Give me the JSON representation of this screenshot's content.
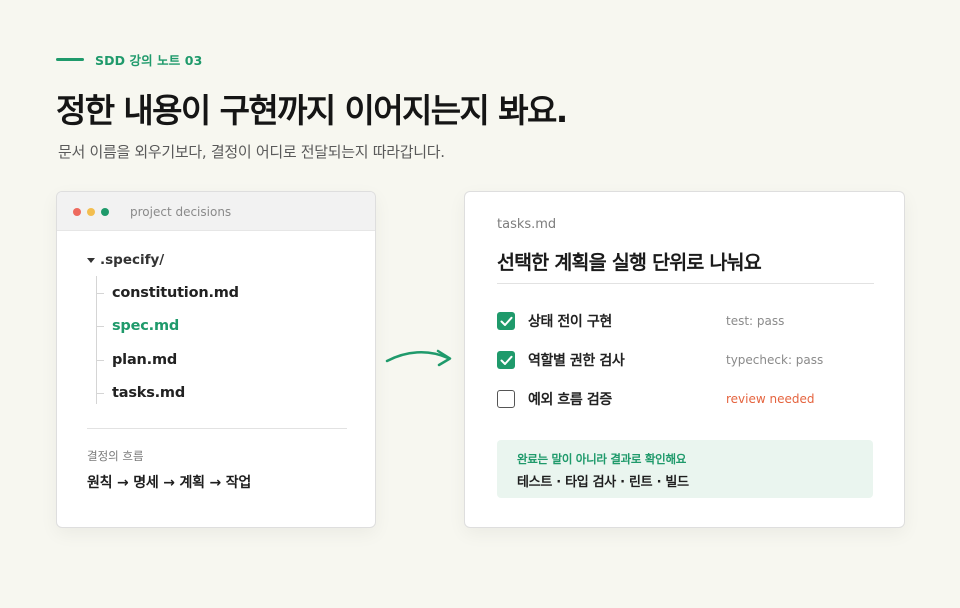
{
  "header": {
    "eyebrow": "SDD 강의 노트 03",
    "headline": "정한 내용이 구현까지 이어지는지 봐요.",
    "subtitle": "문서 이름을 외우기보다, 결정이 어디로 전달되는지 따라갑니다."
  },
  "left_panel": {
    "window_title": "project decisions",
    "folder": ".specify/",
    "files": [
      {
        "name": "constitution.md",
        "active": false
      },
      {
        "name": "spec.md",
        "active": true
      },
      {
        "name": "plan.md",
        "active": false
      },
      {
        "name": "tasks.md",
        "active": false
      }
    ],
    "flow_label": "결정의 흐름",
    "flow_value": "원칙 → 명세 → 계획 → 작업"
  },
  "right_panel": {
    "file_name": "tasks.md",
    "title": "선택한 계획을 실행 단위로 나눠요",
    "tasks": [
      {
        "label": "상태 전이 구현",
        "status": "test: pass",
        "checked": true
      },
      {
        "label": "역할별 권한 검사",
        "status": "typecheck: pass",
        "checked": true
      },
      {
        "label": "예외 흐름 검증",
        "status": "review needed",
        "checked": false
      }
    ],
    "callout": {
      "title": "완료는 말이 아니라 결과로 확인해요",
      "body": "테스트 · 타입 검사 · 린트 · 빌드"
    }
  },
  "colors": {
    "accent": "#1f9a6b",
    "warning": "#e5643f",
    "background": "#f7f7f0",
    "callout_bg": "#eaf5ef"
  },
  "icons": [
    "caret-down-icon",
    "arrow-right-icon",
    "checkmark-icon"
  ]
}
